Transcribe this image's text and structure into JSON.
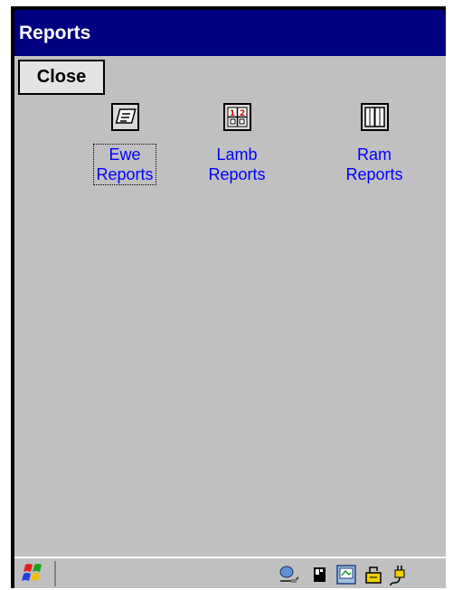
{
  "window": {
    "title": "Reports"
  },
  "toolbar": {
    "close_label": "Close"
  },
  "reports": {
    "ewe": "Ewe\nReports",
    "lamb": "Lamb\nReports",
    "ram": "Ram\nReports"
  },
  "taskbar": {
    "start_icon": "windows-flag-icon",
    "tray_icons": [
      "network-icon",
      "memory-card-icon",
      "display-settings-icon",
      "battery-icon",
      "power-plug-icon"
    ]
  },
  "colors": {
    "titlebar": "#000080",
    "screen_bg": "#c0c0c0",
    "link_text": "#0000ff"
  }
}
